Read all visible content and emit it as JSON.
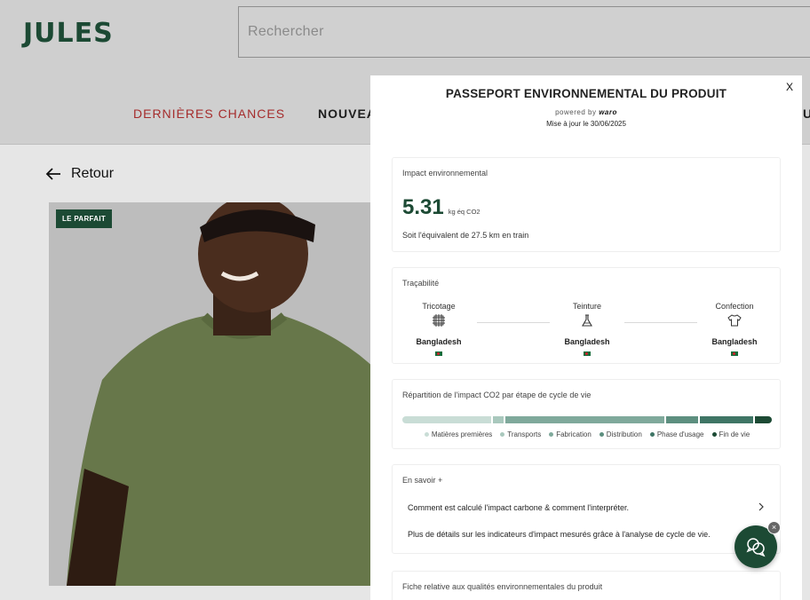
{
  "site": {
    "logo": "JULES",
    "search_placeholder": "Rechercher",
    "nav": [
      "DERNIÈRES CHANCES",
      "NOUVEA",
      "U"
    ],
    "back_label": "Retour",
    "product_badge": "LE PARFAIT"
  },
  "modal": {
    "close_label": "X",
    "title": "PASSEPORT ENVIRONNEMENTAL DU PRODUIT",
    "powered_by": "powered by",
    "powered_brand": "waro",
    "updated": "Mise à jour le 30/06/2025",
    "impact": {
      "heading": "Impact environnemental",
      "value": "5.31",
      "unit": "kg éq CO2",
      "equivalent": "Soit l'équivalent de 27.5 km en train"
    },
    "traceability": {
      "heading": "Traçabilité",
      "steps": [
        {
          "label": "Tricotage",
          "country": "Bangladesh",
          "icon": "knitting-icon"
        },
        {
          "label": "Teinture",
          "country": "Bangladesh",
          "icon": "flask-icon"
        },
        {
          "label": "Confection",
          "country": "Bangladesh",
          "icon": "tshirt-icon"
        }
      ]
    },
    "lifecycle": {
      "heading": "Répartition de l'impact CO2 par étape de cycle de vie",
      "segments": [
        {
          "name": "Matières premières",
          "share": 0.245,
          "color": "#c9ddd6"
        },
        {
          "name": "Transports",
          "share": 0.035,
          "color": "#a9c8bd"
        },
        {
          "name": "Fabrication",
          "share": 0.435,
          "color": "#7fa99b"
        },
        {
          "name": "Distribution",
          "share": 0.09,
          "color": "#5d8f7f"
        },
        {
          "name": "Phase d'usage",
          "share": 0.15,
          "color": "#3f7565"
        },
        {
          "name": "Fin de vie",
          "share": 0.045,
          "color": "#1c4a34"
        }
      ]
    },
    "learn_more": {
      "heading": "En savoir +",
      "link1": "Comment est calculé l'impact carbone & comment l'interpréter.",
      "link2": "Plus de détails sur les indicateurs d'impact mesurés grâce à l'analyse de cycle de vie."
    },
    "quality_sheet": "Fiche relative aux qualités environnementales du produit"
  },
  "chat": {
    "close_label": "×"
  }
}
